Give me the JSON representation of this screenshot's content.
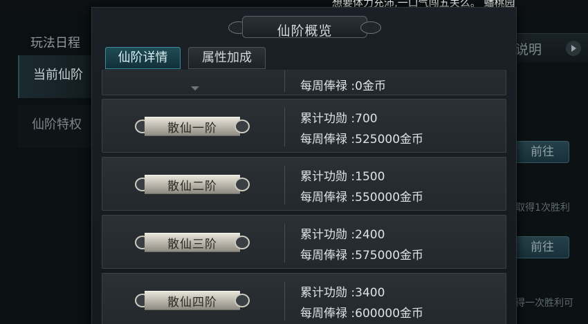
{
  "background": {
    "ticker": "想要体力充沛,一口气闯五关么。 蟠桃园",
    "left_title": "玩法日程",
    "left_items": [
      "当前仙阶",
      "仙阶特权"
    ],
    "right_tab": "说明",
    "go_buttons": [
      "前往",
      "前往"
    ],
    "notes": [
      "取得1次胜利",
      "得一次胜利可"
    ]
  },
  "panel": {
    "title": "仙阶概览",
    "tabs": [
      "仙阶详情",
      "属性加成"
    ],
    "partial_row": {
      "salary": "每周俸禄 :0金币"
    },
    "ranks": [
      {
        "name": "散仙一阶",
        "merit": "累计功勋 :700",
        "salary": "每周俸禄 :525000金币"
      },
      {
        "name": "散仙二阶",
        "merit": "累计功勋 :1500",
        "salary": "每周俸禄 :550000金币"
      },
      {
        "name": "散仙三阶",
        "merit": "累计功勋 :2400",
        "salary": "每周俸禄 :575000金币"
      },
      {
        "name": "散仙四阶",
        "merit": "累计功勋 :3400",
        "salary": "每周俸禄 :600000金币"
      }
    ]
  }
}
